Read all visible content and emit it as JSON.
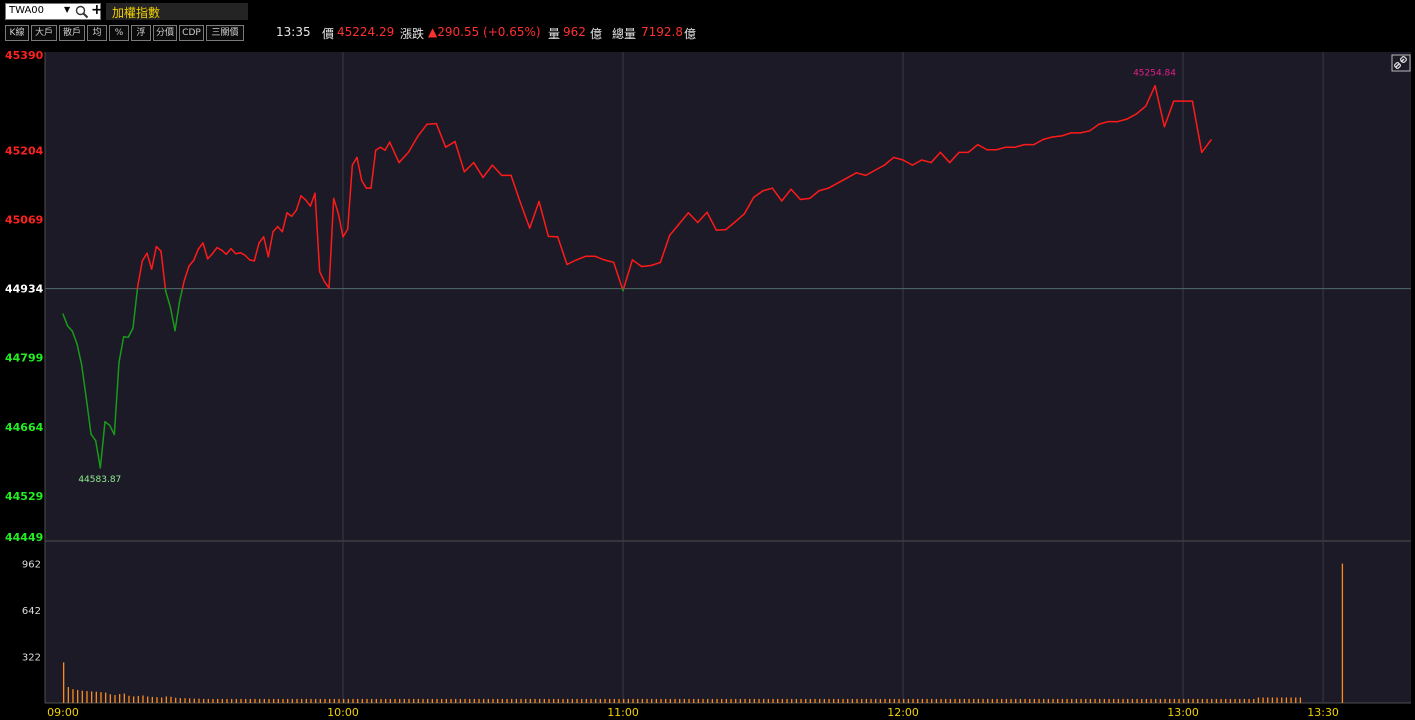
{
  "toolbar": {
    "symbol": "TWA00",
    "index_name": "加權指數"
  },
  "buttons": [
    "K線",
    "大戶",
    "散戶",
    "均",
    "%",
    "浮",
    "分價",
    "CDP",
    "三關價"
  ],
  "quote": {
    "time": "13:35",
    "price_label": "價",
    "price": "45224.29",
    "change_label": "漲跌",
    "change": "▲290.55 (+0.65%)",
    "volume_label": "量",
    "volume": "962",
    "volume_unit": "億",
    "total_label": "總量",
    "total": "7192.8",
    "total_unit": "億"
  },
  "colors": {
    "up": "#ff1a1a",
    "down": "#1a9a1a",
    "ref_line": "#4f6a6a",
    "volume": "#ff8c1a",
    "axis_time": "#f2d100"
  },
  "icons": {
    "link": "link-icon",
    "search": "search-icon"
  },
  "chart_data": [
    {
      "type": "line",
      "reference": 44934,
      "ylim": [
        44449,
        45390
      ],
      "yticks": [
        {
          "value": 45390,
          "label": "45390"
        },
        {
          "value": 45204,
          "label": "45204"
        },
        {
          "value": 45069,
          "label": "45069"
        },
        {
          "value": 44934,
          "label": "44934"
        },
        {
          "value": 44799,
          "label": "44799"
        },
        {
          "value": 44664,
          "label": "44664"
        },
        {
          "value": 44529,
          "label": "44529"
        },
        {
          "value": 44449,
          "label": "44449"
        }
      ],
      "x_minutes_from_open": [
        0,
        1,
        2,
        3,
        4,
        5,
        6,
        7,
        8,
        9,
        10,
        11,
        12,
        13,
        14,
        15,
        16,
        17,
        18,
        19,
        20,
        21,
        22,
        23,
        24,
        25,
        26,
        27,
        28,
        29,
        30,
        31,
        32,
        33,
        34,
        35,
        36,
        37,
        38,
        39,
        40,
        41,
        42,
        43,
        44,
        45,
        46,
        47,
        48,
        49,
        50,
        51,
        52,
        53,
        54,
        55,
        56,
        57,
        58,
        59,
        60,
        61,
        62,
        63,
        64,
        65,
        66,
        67,
        68,
        69,
        70,
        72,
        74,
        76,
        78,
        80,
        82,
        84,
        86,
        88,
        90,
        92,
        94,
        96,
        98,
        100,
        102,
        104,
        106,
        108,
        110,
        112,
        114,
        116,
        118,
        120,
        122,
        124,
        126,
        128,
        130,
        132,
        134,
        136,
        138,
        140,
        142,
        144,
        146,
        148,
        150,
        152,
        154,
        156,
        158,
        160,
        162,
        164,
        166,
        168,
        170,
        172,
        174,
        176,
        178,
        180,
        182,
        184,
        186,
        188,
        190,
        192,
        194,
        196,
        198,
        200,
        202,
        204,
        206,
        208,
        210,
        212,
        214,
        216,
        218,
        220,
        222,
        224,
        226,
        228,
        230,
        232,
        234,
        236,
        238,
        240,
        242,
        244,
        246,
        250,
        254,
        258,
        262,
        266,
        270,
        270.5
      ],
      "values": [
        44884,
        44861,
        44851,
        44826,
        44785,
        44719,
        44650,
        44637,
        44583.87,
        44674,
        44667,
        44649,
        44790,
        44840,
        44839,
        44857,
        44938,
        44988,
        45003,
        44972,
        45016,
        45007,
        44929,
        44898,
        44852,
        44910,
        44950,
        44978,
        44989,
        45011,
        45023,
        44992,
        45002,
        45014,
        45009,
        45001,
        45012,
        45002,
        45004,
        44999,
        44990,
        44988,
        45023,
        45035,
        44996,
        45045,
        45055,
        45045,
        45082,
        45075,
        45087,
        45115,
        45107,
        45095,
        45120,
        44967,
        44948,
        44935,
        45110,
        45080,
        45035,
        45050,
        45175,
        45190,
        45145,
        45130,
        45130,
        45204,
        45210,
        45204,
        45220,
        45180,
        45200,
        45231,
        45254.84,
        45256,
        45210,
        45221,
        45162,
        45180,
        45151,
        45175,
        45155,
        45155,
        45102,
        45052,
        45104,
        45036,
        45035,
        44981,
        44990,
        44997,
        44997,
        44990,
        44985,
        44930,
        44990,
        44977,
        44979,
        44985,
        45038,
        45060,
        45082,
        45063,
        45083,
        45048,
        45049,
        45064,
        45080,
        45112,
        45125,
        45130,
        45105,
        45128,
        45108,
        45110,
        45125,
        45130,
        45140,
        45150,
        45160,
        45155,
        45165,
        45175,
        45190,
        45185,
        45175,
        45185,
        45180,
        45200,
        45180,
        45200,
        45200,
        45215,
        45205,
        45205,
        45210,
        45210,
        45215,
        45215,
        45225,
        45230,
        45232,
        45238,
        45238,
        45242,
        45255,
        45260,
        45260,
        45265,
        45275,
        45290,
        45330,
        45250,
        45300,
        45300,
        45300,
        45200,
        45224.29
      ],
      "high_label": "45254.84",
      "low_label": "44583.87"
    },
    {
      "type": "bar",
      "series": "volume",
      "ylim": [
        0,
        1090
      ],
      "yticks": [
        {
          "value": 962,
          "label": "962"
        },
        {
          "value": 642,
          "label": "642"
        },
        {
          "value": 322,
          "label": "322"
        }
      ],
      "first_values": [
        280,
        110,
        95,
        90,
        85,
        82,
        80,
        78,
        75,
        72,
        60,
        55,
        62,
        65,
        50,
        45,
        48,
        52,
        45,
        42,
        40,
        38,
        45,
        43,
        36,
        34,
        33,
        32,
        30,
        30
      ],
      "typical_value": 28,
      "last_value": 962
    }
  ],
  "time_axis": {
    "labels": [
      "09:00",
      "10:00",
      "11:00",
      "12:00",
      "13:00",
      "13:30"
    ],
    "minutes": [
      0,
      60,
      120,
      180,
      240,
      270
    ]
  }
}
